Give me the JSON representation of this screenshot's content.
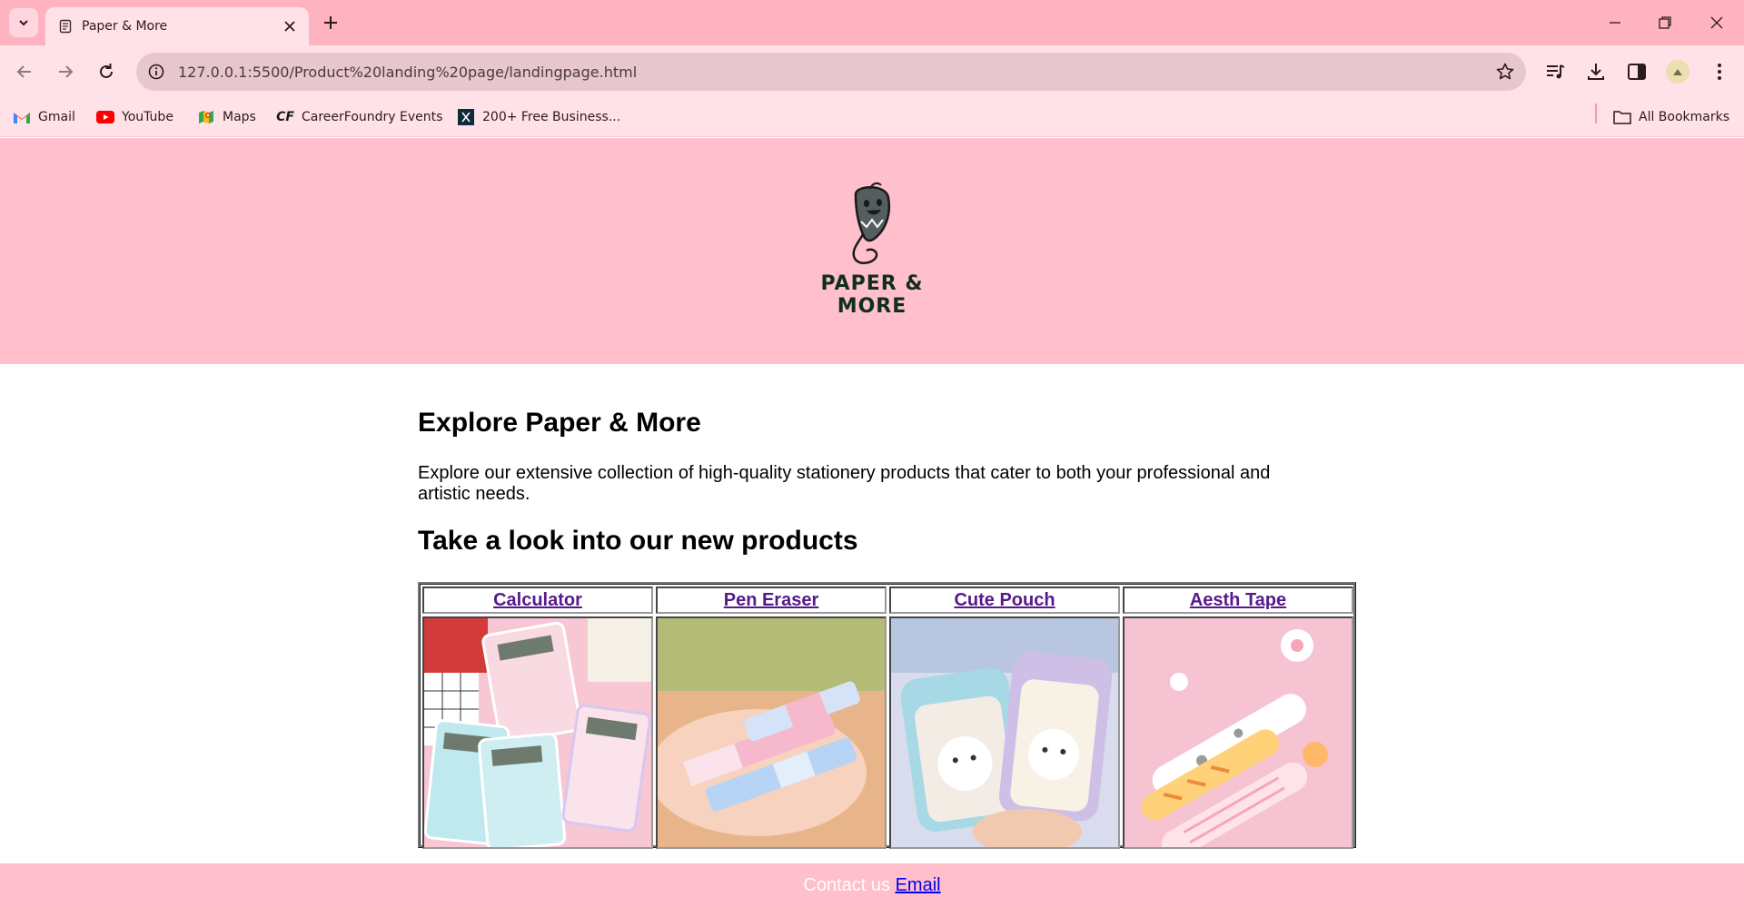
{
  "browser": {
    "tab": {
      "title": "Paper & More"
    },
    "address_bar": {
      "url": "127.0.0.1:5500/Product%20landing%20page/landingpage.html"
    },
    "bookmarks": [
      {
        "label": "Gmail",
        "icon": "gmail-icon"
      },
      {
        "label": "YouTube",
        "icon": "youtube-icon"
      },
      {
        "label": "Maps",
        "icon": "maps-icon"
      },
      {
        "label": "CareerFoundry Events",
        "icon": "careerfoundry-icon"
      },
      {
        "label": "200+ Free Business...",
        "icon": "x-icon"
      }
    ],
    "all_bookmarks_label": "All Bookmarks"
  },
  "header": {
    "logo_text": "PAPER & MORE"
  },
  "main": {
    "title": "Explore Paper & More",
    "intro": "Explore our extensive collection of high-quality stationery products that cater to both your professional and artistic needs.",
    "products_heading": "Take a look into our new products",
    "products": [
      {
        "name": "Calculator",
        "image": "pink glitter calculators photo"
      },
      {
        "name": "Pen Eraser",
        "image": "pastel eraser sticks in hand photo"
      },
      {
        "name": "Cute Pouch",
        "image": "bunny pencil pouch photo"
      },
      {
        "name": "Aesth Tape",
        "image": "cat paw correction tapes photo"
      }
    ]
  },
  "footer": {
    "contact_text": "Contact us",
    "email_link": "Email"
  },
  "colors": {
    "tabstrip": "#ffb3c1",
    "toolbar": "#ffe2e8",
    "header_bg": "#ffbfcc",
    "footer_bg": "#ffbfcc",
    "link_visited": "#551a8b",
    "link": "#0000ee"
  }
}
